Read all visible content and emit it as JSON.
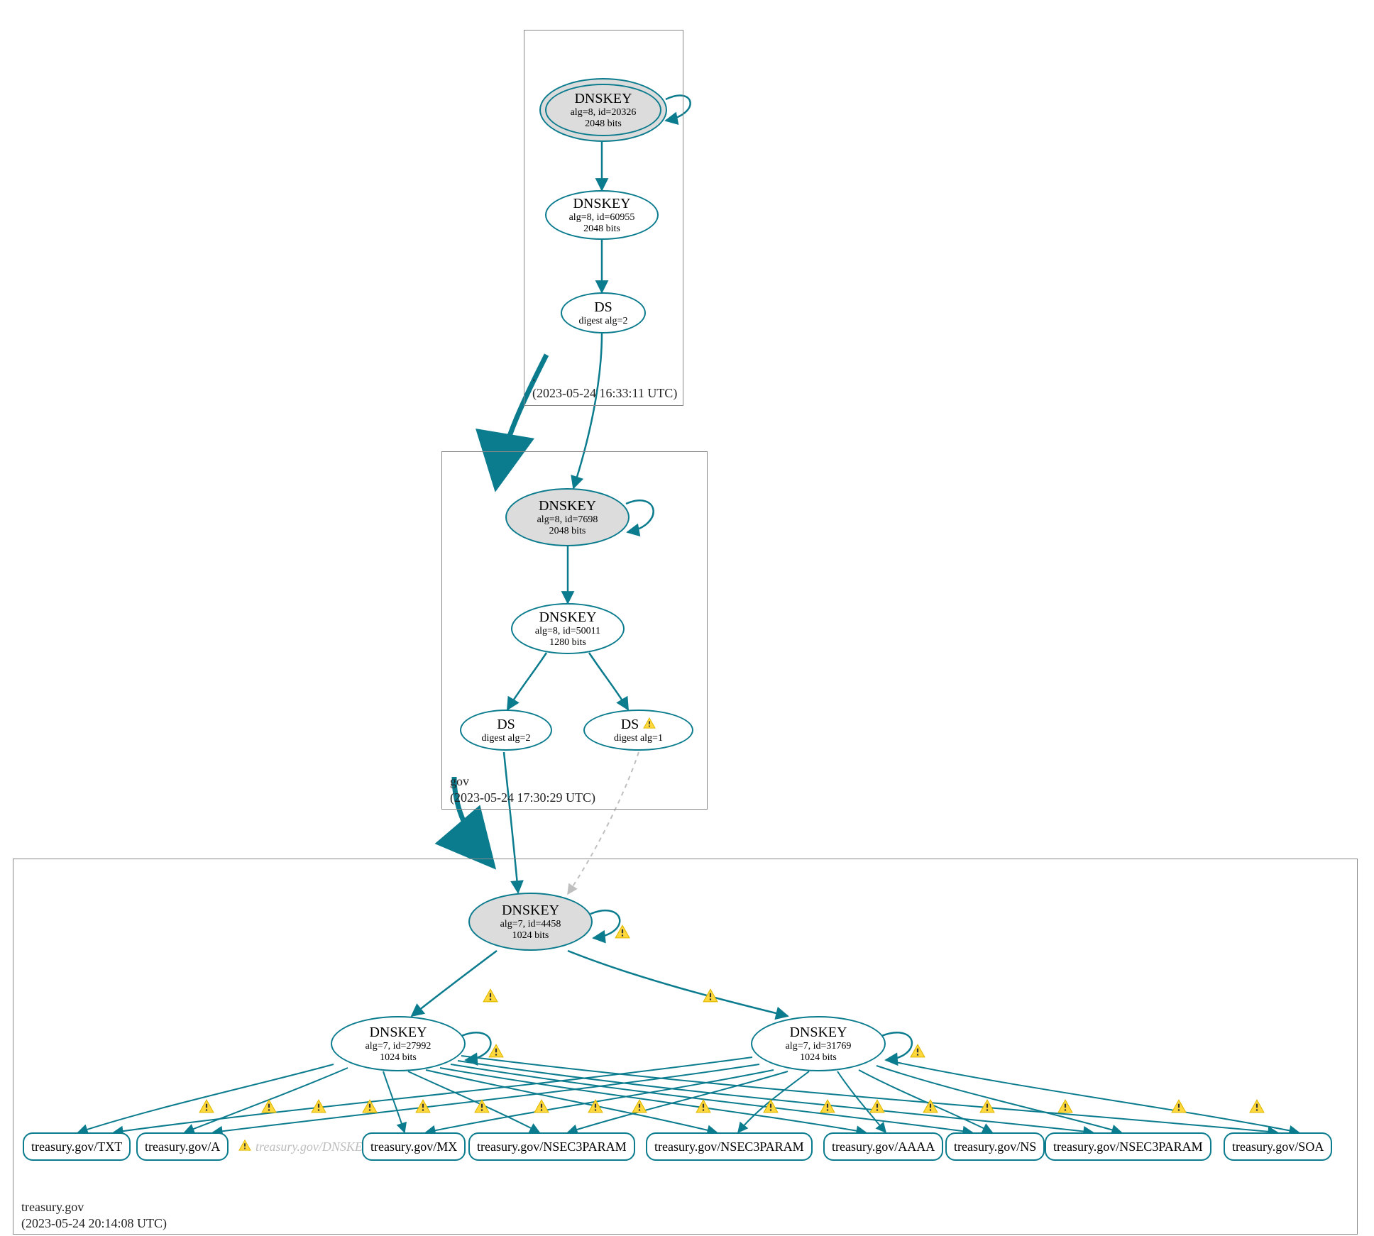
{
  "colors": {
    "teal": "#0b7b8e",
    "grey_fill": "#dcdcdc",
    "zone_border": "#888888",
    "warn_fill": "#ffd83d",
    "warn_stroke": "#e0b900",
    "dashed_grey": "#bfbfbf"
  },
  "zones": {
    "root": {
      "name": ".",
      "timestamp": "(2023-05-24 16:33:11 UTC)"
    },
    "gov": {
      "name": "gov",
      "timestamp": "(2023-05-24 17:30:29 UTC)"
    },
    "treasury": {
      "name": "treasury.gov",
      "timestamp": "(2023-05-24 20:14:08 UTC)"
    }
  },
  "nodes": {
    "root_ksk": {
      "title": "DNSKEY",
      "sub1": "alg=8, id=20326",
      "sub2": "2048 bits"
    },
    "root_zsk": {
      "title": "DNSKEY",
      "sub1": "alg=8, id=60955",
      "sub2": "2048 bits"
    },
    "root_ds": {
      "title": "DS",
      "sub1": "digest alg=2"
    },
    "gov_ksk": {
      "title": "DNSKEY",
      "sub1": "alg=8, id=7698",
      "sub2": "2048 bits"
    },
    "gov_zsk": {
      "title": "DNSKEY",
      "sub1": "alg=8, id=50011",
      "sub2": "1280 bits"
    },
    "gov_ds2": {
      "title": "DS",
      "sub1": "digest alg=2"
    },
    "gov_ds1": {
      "title": "DS",
      "sub1": "digest alg=1"
    },
    "tg_ksk": {
      "title": "DNSKEY",
      "sub1": "alg=7, id=4458",
      "sub2": "1024 bits"
    },
    "tg_zsk_a": {
      "title": "DNSKEY",
      "sub1": "alg=7, id=27992",
      "sub2": "1024 bits"
    },
    "tg_zsk_b": {
      "title": "DNSKEY",
      "sub1": "alg=7, id=31769",
      "sub2": "1024 bits"
    },
    "rr_txt": {
      "label": "treasury.gov/TXT"
    },
    "rr_a": {
      "label": "treasury.gov/A"
    },
    "rr_dnskey_inv": {
      "label": "treasury.gov/DNSKEY"
    },
    "rr_mx": {
      "label": "treasury.gov/MX"
    },
    "rr_n3p_1": {
      "label": "treasury.gov/NSEC3PARAM"
    },
    "rr_n3p_2": {
      "label": "treasury.gov/NSEC3PARAM"
    },
    "rr_aaaa": {
      "label": "treasury.gov/AAAA"
    },
    "rr_ns": {
      "label": "treasury.gov/NS"
    },
    "rr_n3p_3": {
      "label": "treasury.gov/NSEC3PARAM"
    },
    "rr_soa": {
      "label": "treasury.gov/SOA"
    }
  }
}
